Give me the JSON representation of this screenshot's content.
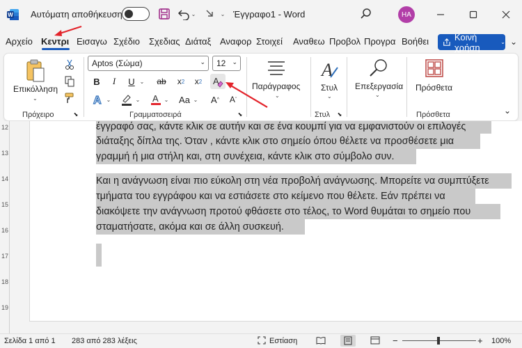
{
  "titlebar": {
    "autosave_label": "Αυτόματη αποθήκευση",
    "doc_title": "Έγγραφο1 - Word",
    "avatar_initials": "HA"
  },
  "tabs": [
    "Αρχείο",
    "Κεντρι",
    "Εισαγω",
    "Σχέδιο",
    "Σχεδιας",
    "Διάταξ",
    "Αναφορ",
    "Στοιχεί",
    "Αναθεω",
    "Προβολ",
    "Προγρα",
    "Βοήθει"
  ],
  "share_label": "Κοινή χρήση",
  "ribbon": {
    "clipboard": {
      "paste_label": "Επικόλληση",
      "group_label": "Πρόχειρο"
    },
    "font": {
      "font_name": "Aptos (Σώμα)",
      "font_size": "12",
      "group_label": "Γραμματοσειρά"
    },
    "paragraph": {
      "label": "Παράγραφος"
    },
    "styles": {
      "label": "Στυλ",
      "group_label": "Στυλ"
    },
    "editing": {
      "label": "Επεξεργασία"
    },
    "addins": {
      "label": "Πρόσθετα",
      "group_label": "Πρόσθετα"
    }
  },
  "document": {
    "lines": [
      "έγγραφό σας, κάντε κλικ σε αυτήν και σε ένα κουμπί για να εμφανιστούν οι επιλογές",
      "διάταξης δίπλα της. Όταν , κάντε κλικ στο σημείο όπου θέλετε να προσθέσετε μια",
      "γραμμή ή μια στήλη και, στη συνέχεια, κάντε κλικ στο σύμβολο συν.",
      "Και η ανάγνωση είναι πιο εύκολη στη νέα προβολή ανάγνωσης. Μπορείτε να συμπτύξετε",
      "τμήματα του εγγράφου και να εστιάσετε στο κείμενο που θέλετε. Εάν πρέπει να",
      "διακόψετε την ανάγνωση προτού φθάσετε στο τέλος, το Word θυμάται το σημείο που",
      "σταματήσατε, ακόμα και σε άλλη συσκευή."
    ]
  },
  "ruler_numbers": [
    "12",
    "13",
    "14",
    "15",
    "16",
    "17",
    "18",
    "19"
  ],
  "statusbar": {
    "page": "Σελίδα 1 από 1",
    "words": "283 από 283 λέξεις",
    "focus": "Εστίαση",
    "zoom": "100%"
  },
  "colors": {
    "accent": "#185abd",
    "selection": "#c9c9c9",
    "annotation_arrow": "#e3242b",
    "avatar": "#b23ea8",
    "save_icon": "#a02e8a"
  }
}
